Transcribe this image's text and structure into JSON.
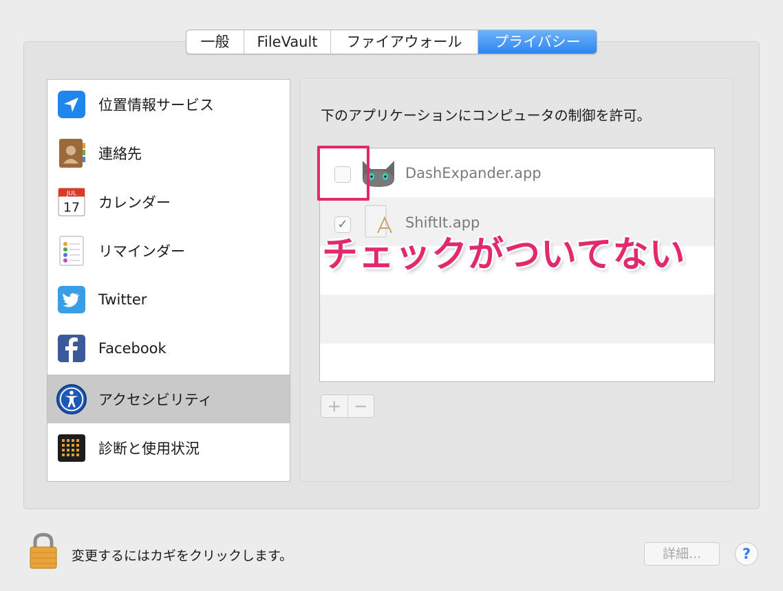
{
  "tabs": [
    "一般",
    "FileVault",
    "ファイアウォール",
    "プライバシー"
  ],
  "active_tab": "プライバシー",
  "sidebar": {
    "items": [
      {
        "label": "位置情報サービス",
        "icon": "location-arrow-icon"
      },
      {
        "label": "連絡先",
        "icon": "contacts-book-icon"
      },
      {
        "label": "カレンダー",
        "icon": "calendar-icon",
        "icon_month": "JUL",
        "icon_day": "17"
      },
      {
        "label": "リマインダー",
        "icon": "reminders-list-icon"
      },
      {
        "label": "Twitter",
        "icon": "twitter-bird-icon"
      },
      {
        "label": "Facebook",
        "icon": "facebook-f-icon"
      },
      {
        "label": "アクセシビリティ",
        "icon": "accessibility-person-icon",
        "selected": true
      },
      {
        "label": "診断と使用状況",
        "icon": "diagnostics-grid-icon"
      }
    ]
  },
  "main": {
    "title": "下のアプリケーションにコンピュータの制御を許可。",
    "apps": [
      {
        "name": "DashExpander.app",
        "checked": false,
        "icon": "cat-face-icon"
      },
      {
        "name": "ShiftIt.app",
        "checked": true,
        "check_glyph": "✓",
        "icon": "app-document-icon"
      }
    ],
    "add_label": "+",
    "remove_label": "−"
  },
  "annotation": {
    "text": "チェックがついてない",
    "color": "#e3296b"
  },
  "footer": {
    "lock_text": "変更するにはカギをクリックします。",
    "details_label": "詳細...",
    "help_label": "?"
  },
  "colors": {
    "accent_tab": "#2f84f1",
    "selected_row": "#c9c9c9",
    "annotation": "#e3296b"
  }
}
